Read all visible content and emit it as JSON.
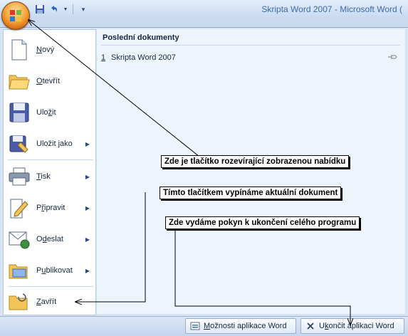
{
  "window": {
    "title": "Skripta Word 2007 - Microsoft Word ("
  },
  "menu": {
    "items": [
      {
        "key": "N",
        "rest": "ový",
        "submenu": false
      },
      {
        "pre": "",
        "key": "O",
        "rest": "tevřít",
        "submenu": false
      },
      {
        "pre": "Ulo",
        "key": "ž",
        "rest": "it",
        "submenu": false
      },
      {
        "pre": "Uložit ",
        "key": "j",
        "rest": "ako",
        "submenu": true
      },
      {
        "pre": "",
        "key": "T",
        "rest": "isk",
        "submenu": true
      },
      {
        "pre": "P",
        "key": "ř",
        "rest": "ipravit",
        "submenu": true
      },
      {
        "pre": "O",
        "key": "d",
        "rest": "eslat",
        "submenu": true
      },
      {
        "pre": "P",
        "key": "u",
        "rest": "blikovat",
        "submenu": true
      },
      {
        "pre": "",
        "key": "Z",
        "rest": "avřít",
        "submenu": false
      }
    ],
    "recent_title": "Poslední dokumenty",
    "recent": [
      {
        "num": "1",
        "name": "Skripta Word 2007"
      }
    ]
  },
  "bottom": {
    "options_pre": "",
    "options_key": "M",
    "options_rest": "ožnosti aplikace Word",
    "exit_pre": "U",
    "exit_key": "k",
    "exit_rest": "ončit aplikaci Word"
  },
  "annotations": {
    "orb_note": "Zde je tlačítko rozevírající zobrazenou nabídku",
    "close_note": "Tímto tlačítkem vypínáme aktuální dokument",
    "exit_note": "Zde vydáme pokyn k ukončení celého programu"
  },
  "colors": {
    "orb": "#f6a43a",
    "title_text": "#3e6aa6",
    "menu_bg": "#d7e4f5"
  }
}
